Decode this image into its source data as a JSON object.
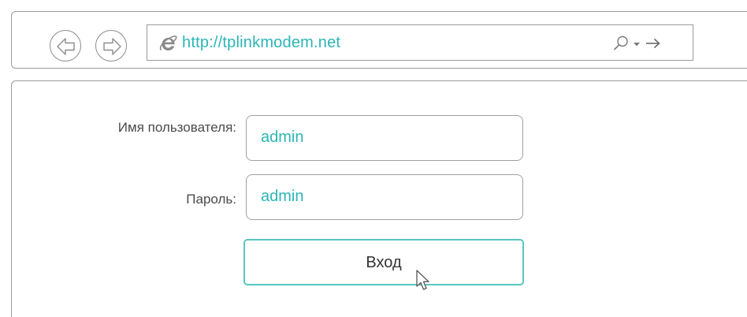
{
  "browser": {
    "url": "http://tplinkmodem.net",
    "icons": {
      "back": "back-arrow-icon",
      "forward": "forward-arrow-icon",
      "browser": "internet-explorer-icon",
      "search": "search-icon",
      "dropdown": "dropdown-icon",
      "go": "go-arrow-icon"
    }
  },
  "login_form": {
    "username_label": "Имя пользователя:",
    "username_value": "admin",
    "password_label": "Пароль:",
    "password_value": "admin",
    "submit_label": "Вход"
  },
  "colors": {
    "accent": "#2cb5b5",
    "button_border": "#5ac5c2",
    "frame_border": "#9a9a9a"
  }
}
